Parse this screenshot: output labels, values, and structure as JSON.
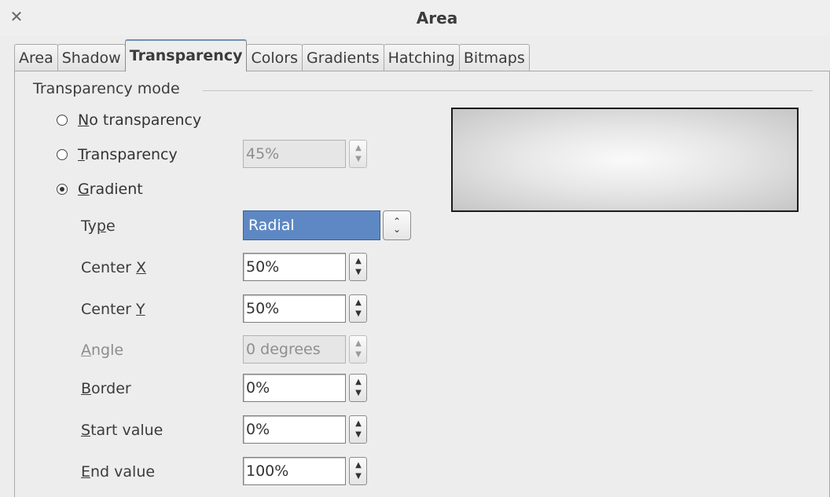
{
  "window": {
    "title": "Area",
    "close_icon": "close-icon"
  },
  "tabs": [
    {
      "label": "Area",
      "active": false
    },
    {
      "label": "Shadow",
      "active": false
    },
    {
      "label": "Transparency",
      "active": true
    },
    {
      "label": "Colors",
      "active": false
    },
    {
      "label": "Gradients",
      "active": false
    },
    {
      "label": "Hatching",
      "active": false
    },
    {
      "label": "Bitmaps",
      "active": false
    }
  ],
  "transparency_mode": {
    "legend": "Transparency mode",
    "options": {
      "no_transparency": {
        "label_mnemonic": "N",
        "label_rest": "o transparency",
        "selected": false
      },
      "transparency": {
        "label_mnemonic": "T",
        "label_rest": "ransparency",
        "selected": false,
        "value": "45%"
      },
      "gradient": {
        "label_mnemonic": "G",
        "label_rest": "radient",
        "selected": true
      }
    }
  },
  "gradient": {
    "type": {
      "label_pre": "Ty",
      "label_mnemonic": "p",
      "label_post": "e",
      "value": "Radial"
    },
    "center_x": {
      "label_pre": "Center ",
      "label_mnemonic": "X",
      "label_post": "",
      "value": "50%"
    },
    "center_y": {
      "label_pre": "Center ",
      "label_mnemonic": "Y",
      "label_post": "",
      "value": "50%"
    },
    "angle": {
      "label_pre": "",
      "label_mnemonic": "A",
      "label_post": "ngle",
      "value": "0 degrees",
      "enabled": false
    },
    "border": {
      "label_pre": "",
      "label_mnemonic": "B",
      "label_post": "order",
      "value": "0%"
    },
    "start_value": {
      "label_pre": "",
      "label_mnemonic": "S",
      "label_post": "tart value",
      "value": "0%"
    },
    "end_value": {
      "label_pre": "",
      "label_mnemonic": "E",
      "label_post": "nd value",
      "value": "100%"
    }
  },
  "colors": {
    "selection": "#5e88c4",
    "preview_center": "#fafafa",
    "preview_edge": "#c6c6c6"
  }
}
